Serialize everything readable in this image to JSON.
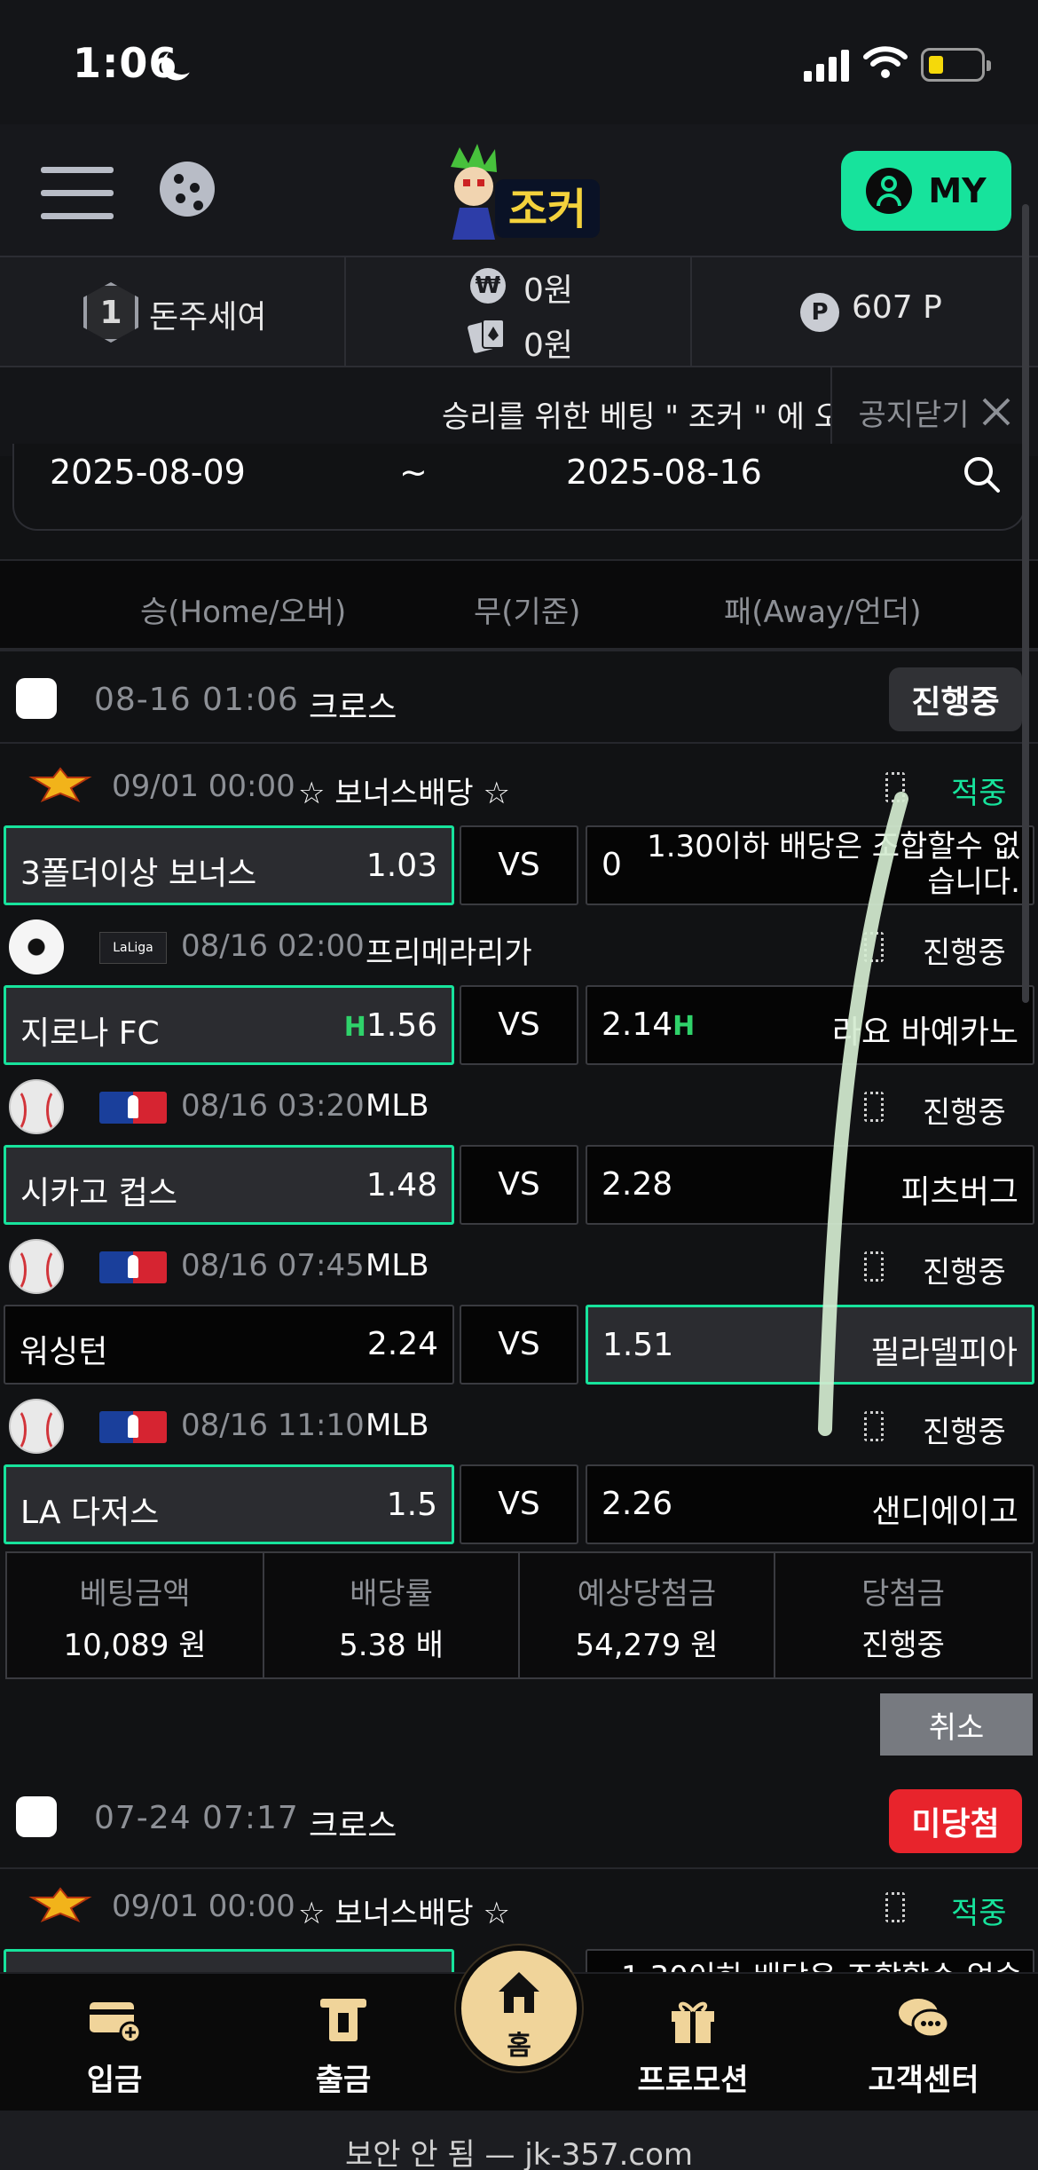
{
  "status_bar": {
    "time": "1:06"
  },
  "header": {
    "logo_text": "조커",
    "my_label": "MY"
  },
  "info": {
    "rank_num": "1",
    "username": "돈주세여",
    "won_icon": "₩",
    "cash": "0원",
    "casino": "0원",
    "point_icon": "P",
    "points": "607 P"
  },
  "notice": {
    "text": "승리를 위한 베팅 \" 조커 \" 에 오",
    "close_label": "공지닫기"
  },
  "date_filter": {
    "from": "2025-08-09",
    "sep": "~",
    "to": "2025-08-16"
  },
  "columns": {
    "home": "승(Home/오버)",
    "draw": "무(기준)",
    "away": "패(Away/언더)"
  },
  "sections": [
    {
      "date": "08-16 01:06",
      "type": "크로스",
      "status": "진행중",
      "bonus": {
        "date": "09/01 00:00",
        "title": "☆ 보너스배당 ☆",
        "status": "적중",
        "home": "3폴더이상 보너스",
        "home_odd": "1.03",
        "vs": "VS",
        "away_odd": "0",
        "away": "1.30이하 배당은 조합할수 없습니다."
      },
      "games": [
        {
          "date": "08/16 02:00",
          "league": "프리메라리가",
          "status": "진행중",
          "home": "지로나 FC",
          "home_mark": "H",
          "home_odd": "1.56",
          "vs": "VS",
          "away_odd": "2.14",
          "away_mark": "H",
          "away": "라요 바예카노"
        },
        {
          "date": "08/16 03:20",
          "league": "MLB",
          "status": "진행중",
          "home": "시카고 컵스",
          "home_odd": "1.48",
          "vs": "VS",
          "away_odd": "2.28",
          "away": "피츠버그"
        },
        {
          "date": "08/16 07:45",
          "league": "MLB",
          "status": "진행중",
          "home": "워싱턴",
          "home_odd": "2.24",
          "vs": "VS",
          "away_odd": "1.51",
          "away": "필라델피아"
        },
        {
          "date": "08/16 11:10",
          "league": "MLB",
          "status": "진행중",
          "home": "LA 다저스",
          "home_odd": "1.5",
          "vs": "VS",
          "away_odd": "2.26",
          "away": "샌디에이고"
        }
      ],
      "summary": {
        "bet_label": "베팅금액",
        "bet": "10,089 원",
        "rate_label": "배당률",
        "rate": "5.38 배",
        "expect_label": "예상당첨금",
        "expect": "54,279 원",
        "win_label": "당첨금",
        "win": "진행중"
      },
      "cancel_label": "취소"
    },
    {
      "date": "07-24 07:17",
      "type": "크로스",
      "status": "미당첨",
      "bonus": {
        "date": "09/01 00:00",
        "title": "☆ 보너스배당 ☆",
        "status": "적중",
        "away": "1.30이하 배당은 조합할수 없습"
      }
    }
  ],
  "bottom_nav": {
    "deposit": "입금",
    "withdraw": "출금",
    "home": "홈",
    "promo": "프로모션",
    "support": "고객센터"
  },
  "url_bar": {
    "text": "보안 안 됨 — jk-357.com"
  },
  "colors": {
    "accent": "#17e39c",
    "danger": "#e8242c",
    "muted": "#8d9096"
  }
}
